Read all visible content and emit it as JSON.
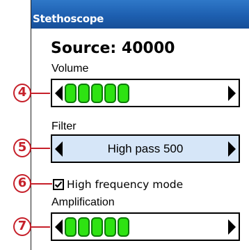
{
  "window": {
    "title": "Stethoscope"
  },
  "source": {
    "title": "Source: 40000"
  },
  "volume": {
    "label": "Volume",
    "level_segments_filled": 5,
    "left_arrow": "left-arrow-icon",
    "right_arrow": "right-arrow-icon"
  },
  "filter": {
    "label": "Filter",
    "value": "High pass 500",
    "selected": true
  },
  "high_frequency": {
    "label": "High frequency mode",
    "checked": true
  },
  "amplification": {
    "label": "Amplification",
    "level_segments_filled": 5
  },
  "callouts": [
    "4",
    "5",
    "6",
    "7"
  ],
  "colors": {
    "title_bar": "#1d5fb0",
    "selected_bg": "#d6e6f8",
    "level_green": "#2ee312",
    "callout_red": "#c6202a"
  }
}
